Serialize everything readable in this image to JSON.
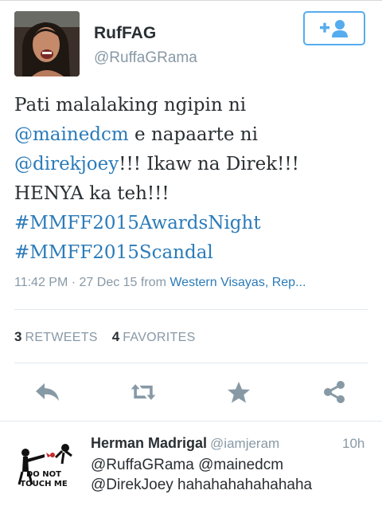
{
  "tweet": {
    "author": {
      "display_name": "RufFAG",
      "handle": "@RuffaGRama"
    },
    "text_lines": [
      [
        {
          "t": "Pati malalaking ngipin ni",
          "link": false
        }
      ],
      [
        {
          "t": "@mainedcm",
          "link": true
        },
        {
          "t": " e napaarte ni",
          "link": false
        }
      ],
      [
        {
          "t": "@direkjoey",
          "link": true
        },
        {
          "t": "!!! Ikaw na Direk!!!",
          "link": false
        }
      ],
      [
        {
          "t": "HENYA ka teh!!!",
          "link": false
        }
      ],
      [
        {
          "t": "#MMFF2015AwardsNight",
          "link": true
        }
      ],
      [
        {
          "t": "#MMFF2015Scandal",
          "link": true
        }
      ]
    ],
    "timestamp": "11:42 PM · 27 Dec 15",
    "from_label": "from",
    "location": "Western Visayas, Rep...",
    "stats": {
      "retweets_count": "3",
      "retweets_label": "RETWEETS",
      "favorites_count": "4",
      "favorites_label": "FAVORITES"
    }
  },
  "actions": [
    {
      "name": "reply-button",
      "icon": "reply-icon"
    },
    {
      "name": "retweet-button",
      "icon": "retweet-icon"
    },
    {
      "name": "favorite-button",
      "icon": "star-icon"
    },
    {
      "name": "share-button",
      "icon": "share-icon"
    }
  ],
  "reply": {
    "display_name": "Herman Madrigal",
    "handle": "@iamjeram",
    "time": "10h",
    "text_lines": [
      "@RuffaGRama @mainedcm",
      "@DirekJoey hahahahahahahaha"
    ],
    "avatar_text": [
      "DO NOT",
      "TOUCH ME"
    ]
  },
  "colors": {
    "accent": "#55acee",
    "link": "#2b7bb9",
    "muted": "#8899a6",
    "icon": "#8899a6"
  }
}
